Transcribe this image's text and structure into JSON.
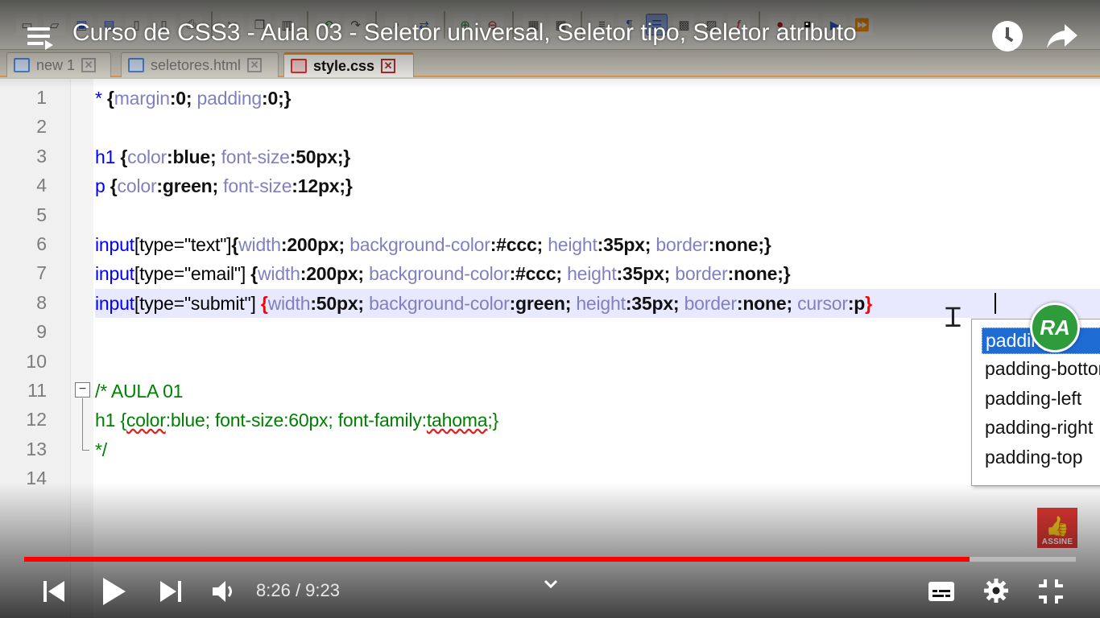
{
  "player": {
    "title": "Curso de CSS3 - Aula 03 - Seletor universal, Seletor tipo, Seletor atributo",
    "time_current": "8:26",
    "time_separator": " / ",
    "time_total": "9:23",
    "progress_fraction": 0.899,
    "accent_color": "#ff0000"
  },
  "editor": {
    "tabs": [
      {
        "label": "new  1",
        "active": false
      },
      {
        "label": "seletores.html",
        "active": false
      },
      {
        "label": "style.css",
        "active": true
      }
    ],
    "line_numbers": [
      "1",
      "2",
      "3",
      "4",
      "5",
      "6",
      "7",
      "8",
      "9",
      "10",
      "11",
      "12",
      "13",
      "14"
    ],
    "code": {
      "l1": [
        "* ",
        "{",
        "margin",
        ":",
        "0",
        "; ",
        "padding",
        ":",
        "0",
        ";}"
      ],
      "l3": [
        "h1",
        " {",
        "color",
        ":",
        "blue",
        "; ",
        "font-size",
        ":",
        "50px",
        ";}"
      ],
      "l4": [
        "p",
        " {",
        "color",
        ":",
        "green",
        "; ",
        "font-size",
        ":",
        "12px",
        ";}"
      ],
      "l6": [
        "input",
        "[type=\"text\"]",
        "{",
        "width",
        ":",
        "200px",
        "; ",
        "background-color",
        ":",
        "#ccc",
        "; ",
        "height",
        ":",
        "35px",
        "; ",
        "border",
        ":",
        "none",
        ";}"
      ],
      "l7": [
        "input",
        "[type=\"email\"]",
        " {",
        "width",
        ":",
        "200px",
        "; ",
        "background-color",
        ":",
        "#ccc",
        "; ",
        "height",
        ":",
        "35px",
        "; ",
        "border",
        ":",
        "none",
        ";}"
      ],
      "l8": [
        "input",
        "[type=\"submit\"]",
        " ",
        "{",
        "width",
        ":",
        "50px",
        "; ",
        "background-color",
        ":",
        "green",
        "; ",
        "height",
        ":",
        "35px",
        "; ",
        "border",
        ":",
        "none",
        "; ",
        "cursor",
        ":",
        "p",
        "}"
      ],
      "l11": "/* AULA 01",
      "l12": [
        "h1 {",
        "color",
        ":blue; font-size:60px; font-family:",
        "tahoma",
        ";}"
      ],
      "l13": "*/"
    },
    "autocomplete": [
      "padding",
      "padding-bottom",
      "padding-left",
      "padding-right",
      "padding-top"
    ],
    "autocomplete_selected": "padding"
  },
  "overlays": {
    "channel_logo": "RA",
    "subscribe_label": "ASSINE"
  },
  "icons": {
    "menu": "menu-icon",
    "watch_later": "clock-icon",
    "share": "share-icon",
    "prev": "skip-previous-icon",
    "play": "play-icon",
    "next": "skip-next-icon",
    "volume": "volume-icon",
    "captions": "captions-icon",
    "settings": "gear-icon",
    "exit_fullscreen": "exit-fullscreen-icon"
  }
}
